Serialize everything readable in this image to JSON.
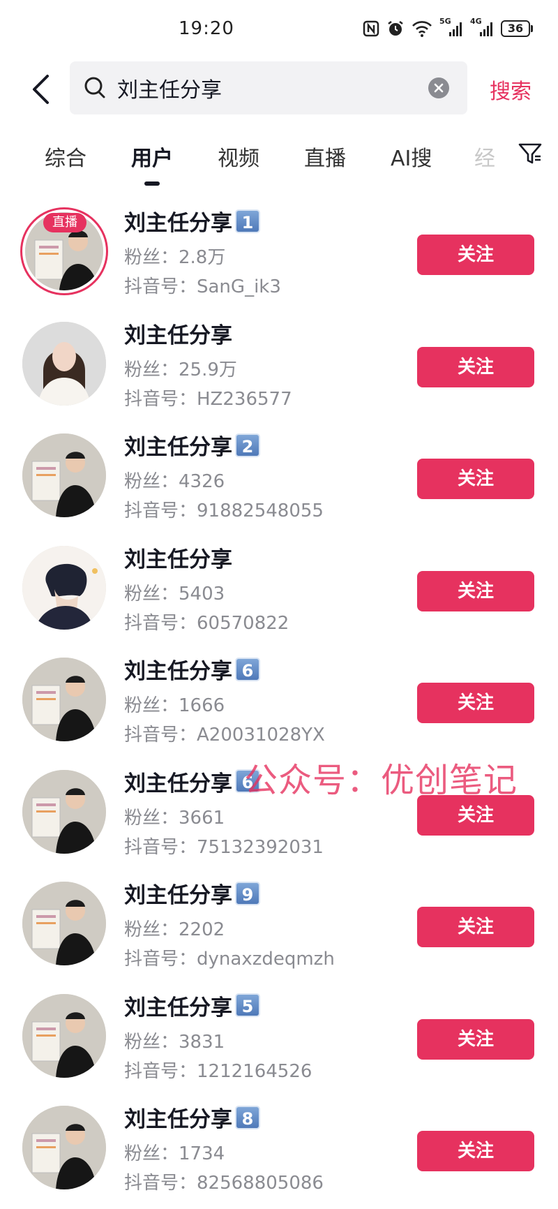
{
  "status_bar": {
    "time": "19:20",
    "signal_1": "5G",
    "signal_2": "4G",
    "battery": "36"
  },
  "search": {
    "query": "刘主任分享",
    "submit_label": "搜索"
  },
  "tabs": [
    {
      "label": "综合"
    },
    {
      "label": "用户",
      "active": true
    },
    {
      "label": "视频"
    },
    {
      "label": "直播"
    },
    {
      "label": "AI搜"
    },
    {
      "label": "经"
    }
  ],
  "watermark": "公众号：优创笔记",
  "users": [
    {
      "name": "刘主任分享",
      "badge": "1",
      "fans": "粉丝：2.8万",
      "douyin_id": "抖音号：SanG_ik3",
      "live_label": "直播",
      "follow": "关注"
    },
    {
      "name": "刘主任分享",
      "badge": "",
      "fans": "粉丝：25.9万",
      "douyin_id": "抖音号：HZ236577",
      "follow": "关注"
    },
    {
      "name": "刘主任分享",
      "badge": "2",
      "fans": "粉丝：4326",
      "douyin_id": "抖音号：91882548055",
      "follow": "关注"
    },
    {
      "name": "刘主任分享",
      "badge": "",
      "fans": "粉丝：5403",
      "douyin_id": "抖音号：60570822",
      "follow": "关注"
    },
    {
      "name": "刘主任分享",
      "badge": "6",
      "fans": "粉丝：1666",
      "douyin_id": "抖音号：A20031028YX",
      "follow": "关注"
    },
    {
      "name": "刘主任分享",
      "badge": "6",
      "fans": "粉丝：3661",
      "douyin_id": "抖音号：75132392031",
      "follow": "关注"
    },
    {
      "name": "刘主任分享",
      "badge": "9",
      "fans": "粉丝：2202",
      "douyin_id": "抖音号：dynaxzdeqmzh",
      "follow": "关注"
    },
    {
      "name": "刘主任分享",
      "badge": "5",
      "fans": "粉丝：3831",
      "douyin_id": "抖音号：1212164526",
      "follow": "关注"
    },
    {
      "name": "刘主任分享",
      "badge": "8",
      "fans": "粉丝：1734",
      "douyin_id": "抖音号：82568805086",
      "follow": "关注"
    }
  ],
  "colors": {
    "accent": "#e6325f",
    "secondary_text": "#8a8b91",
    "search_bg": "#f2f2f4"
  }
}
